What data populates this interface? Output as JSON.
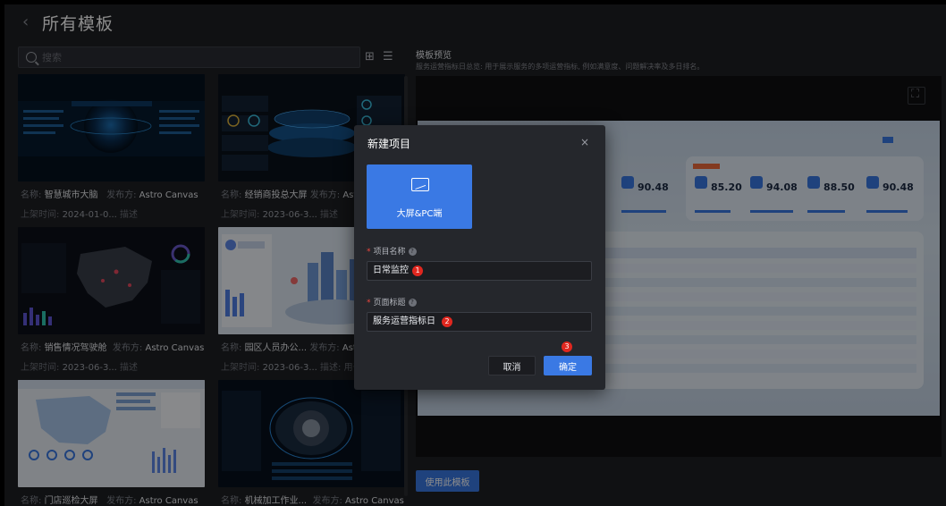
{
  "header": {
    "back_icon": "chevron-left-icon",
    "title": "所有模板"
  },
  "search": {
    "placeholder": "搜索",
    "value": ""
  },
  "view_toggle": {
    "grid_icon": "grid-icon",
    "list_icon": "list-icon",
    "grid_glyph": "⊞",
    "list_glyph": "☰"
  },
  "cards": [
    {
      "name_label": "名称:",
      "name": "智慧城市大脑",
      "publisher_label": "发布方:",
      "publisher": "Astro Canvas",
      "time_label": "上架时间:",
      "time": "2024-01-0...",
      "desc": "描述"
    },
    {
      "name_label": "名称:",
      "name": "经销商投总大屏",
      "publisher_label": "发布方:",
      "publisher": "Astro",
      "time_label": "上架时间:",
      "time": "2023-06-3...",
      "desc": "描述"
    },
    {
      "name_label": "名称:",
      "name": "销售情况驾驶舱",
      "publisher_label": "发布方:",
      "publisher": "Astro Canvas",
      "time_label": "上架时间:",
      "time": "2023-06-3...",
      "desc": "描述"
    },
    {
      "name_label": "名称:",
      "name": "园区人员办公...",
      "publisher_label": "发布方:",
      "publisher": "Astro",
      "time_label": "上架时间:",
      "time": "2023-06-3...",
      "desc": "描述: 用于展"
    },
    {
      "name_label": "名称:",
      "name": "门店巡检大屏",
      "publisher_label": "发布方:",
      "publisher": "Astro Canvas",
      "time_label": "",
      "time": "",
      "desc": ""
    },
    {
      "name_label": "名称:",
      "name": "机械加工作业...",
      "publisher_label": "发布方:",
      "publisher": "Astro Canvas",
      "time_label": "",
      "time": "",
      "desc": ""
    }
  ],
  "preview": {
    "title": "模板预览",
    "description": "服务运营指标日总览: 用于展示服务的多项运营指标, 例如满意度、问题解决率及多日排名。",
    "use_button": "使用此模板",
    "fullscreen_icon": "fullscreen-icon",
    "kpis": [
      "90.48",
      "85.20",
      "94.08",
      "88.50",
      "90.48"
    ]
  },
  "modal": {
    "title": "新建项目",
    "close_glyph": "×",
    "type_card_label": "大屏&PC端",
    "project_name_label": "项目名称",
    "project_name_value": "日常监控",
    "page_title_label": "页面标题",
    "page_title_value": "服务运营指标日",
    "cancel": "取消",
    "ok": "确定",
    "badges": [
      "1",
      "2",
      "3"
    ]
  },
  "colors": {
    "accent": "#3a79e4",
    "badge": "#e0271f",
    "background": "#1e1f23"
  }
}
